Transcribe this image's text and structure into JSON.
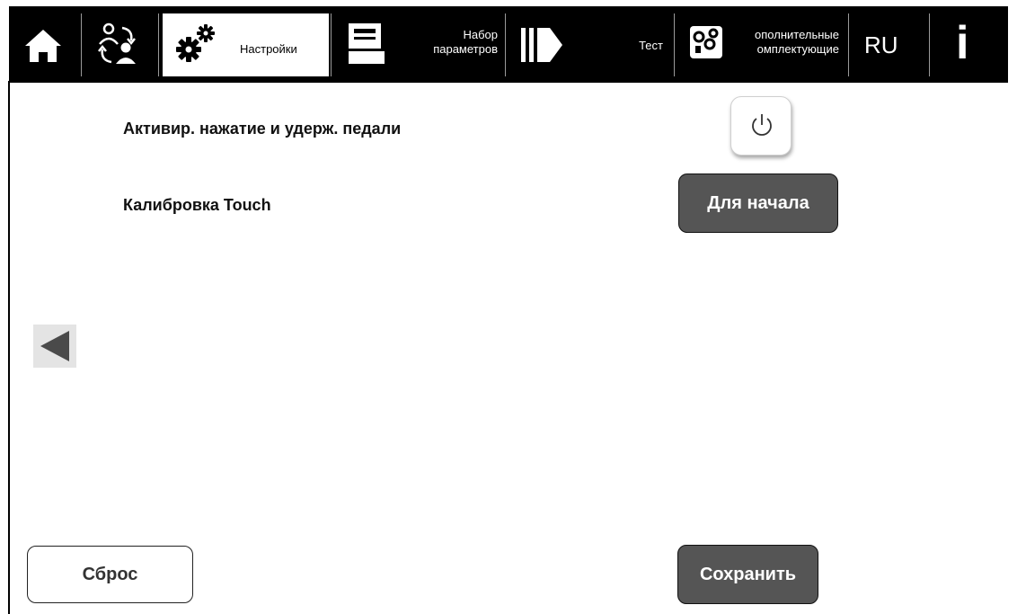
{
  "nav": {
    "home_icon": "home-icon",
    "users_icon": "user-swap-icon",
    "settings": {
      "label": "Настройки",
      "icon": "gears-icon"
    },
    "param_set": {
      "line1": "Набор",
      "line2": "параметров",
      "icon": "monitor-icon"
    },
    "test": {
      "label": "Тест",
      "icon": "play-arrow-icon"
    },
    "accessories": {
      "line1": "ополнительные",
      "line2": "омплектующие",
      "icon": "accessories-icon"
    },
    "language": "RU",
    "info": "i"
  },
  "settings": {
    "pedal_hold_label": "Активир. нажатие и удерж. педали",
    "touch_calibration_label": "Калибровка Touch",
    "start_button": "Для начала"
  },
  "footer": {
    "reset_button": "Сброс",
    "save_button": "Сохранить"
  },
  "colors": {
    "topbar": "#000000",
    "active_tab": "#ffffff",
    "dark_button": "#555555"
  }
}
